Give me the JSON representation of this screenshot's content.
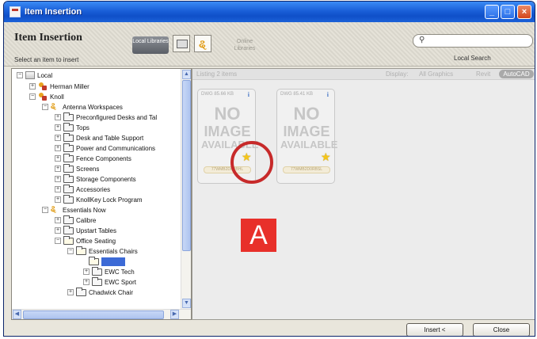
{
  "window": {
    "title": "Item Insertion"
  },
  "header": {
    "title": "Item Insertion",
    "subtitle": "Select an item to insert",
    "local_libraries_label": "Local Libraries",
    "online_libraries_label": "Online Libraries",
    "search_placeholder": "",
    "search_label": "Local Search"
  },
  "tree": {
    "items": [
      {
        "label": "Local",
        "icon": "local-icon",
        "expander": "−"
      },
      {
        "label": "Herman Miller",
        "icon": "person-icon",
        "expander": "+"
      },
      {
        "label": "Knoll",
        "icon": "person-icon",
        "expander": "−"
      },
      {
        "label": "Antenna Workspaces",
        "icon": "org-icon",
        "expander": "−"
      },
      {
        "label": "Preconfigured Desks and Tal",
        "icon": "folder-icon",
        "expander": "+"
      },
      {
        "label": "Tops",
        "icon": "folder-icon",
        "expander": "+"
      },
      {
        "label": "Desk and Table Support",
        "icon": "folder-icon",
        "expander": "+"
      },
      {
        "label": "Power and Communications",
        "icon": "folder-icon",
        "expander": "+"
      },
      {
        "label": "Fence Components",
        "icon": "folder-icon",
        "expander": "+"
      },
      {
        "label": "Screens",
        "icon": "folder-icon",
        "expander": "+"
      },
      {
        "label": "Storage Components",
        "icon": "folder-icon",
        "expander": "+"
      },
      {
        "label": "Accessories",
        "icon": "folder-icon",
        "expander": "+"
      },
      {
        "label": "KnollKey Lock Program",
        "icon": "folder-icon",
        "expander": "+"
      },
      {
        "label": "Essentials Now",
        "icon": "org-icon",
        "expander": "−"
      },
      {
        "label": "Calibre",
        "icon": "folder-icon",
        "expander": "+"
      },
      {
        "label": "Upstart Tables",
        "icon": "folder-icon",
        "expander": "+"
      },
      {
        "label": "Office Seating",
        "icon": "folder-icon",
        "expander": "−"
      },
      {
        "label": "Essentials Chairs",
        "icon": "folder-icon",
        "expander": "−"
      },
      {
        "label": "",
        "icon": "folder-icon",
        "expander": "",
        "selected": true
      },
      {
        "label": "EWC Tech",
        "icon": "folder-icon",
        "expander": "+"
      },
      {
        "label": "EWC Sport",
        "icon": "folder-icon",
        "expander": "+"
      },
      {
        "label": "Chadwick Chair",
        "icon": "folder-icon",
        "expander": "+"
      }
    ]
  },
  "content": {
    "listing": "Listing 2 items",
    "display_label": "Display:",
    "display_options": [
      "All Graphics",
      "Revit",
      "AutoCAD"
    ],
    "cards": [
      {
        "format": "DWG 85.66 KB",
        "info": "i",
        "no_image": [
          "NO",
          "IMAGE",
          "AVAILABLE"
        ],
        "name": "77WMB2D0RBHL"
      },
      {
        "format": "DWG 85.41 KB",
        "info": "i",
        "no_image": [
          "NO",
          "IMAGE",
          "AVAILABLE"
        ],
        "name": "77WMB2D0RBSL"
      }
    ],
    "annotation_label": "A"
  },
  "footer": {
    "insert_label": "Insert <",
    "close_label": "Close"
  },
  "colors": {
    "title_bar": "#1a5fd8",
    "annotation_red": "#e8302a",
    "selection": "#3c6ad6",
    "favorite_star": "#f5c518"
  }
}
